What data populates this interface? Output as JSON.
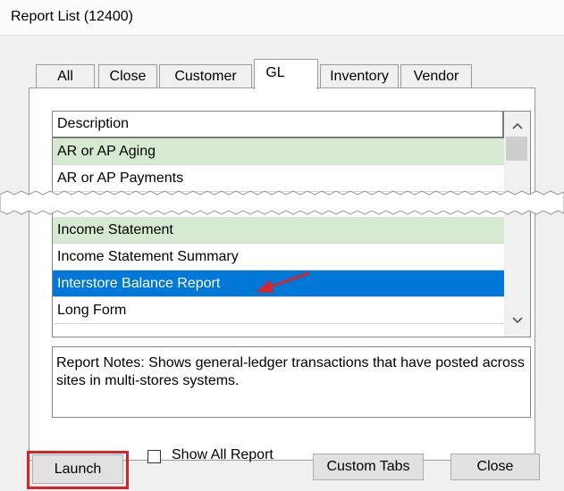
{
  "window": {
    "title": "Report List (12400)"
  },
  "tabs": [
    {
      "label": "All",
      "active": false
    },
    {
      "label": "Close",
      "active": false
    },
    {
      "label": "Customer",
      "active": false
    },
    {
      "label": "GL",
      "active": true
    },
    {
      "label": "Inventory",
      "active": false
    },
    {
      "label": "Vendor",
      "active": false
    }
  ],
  "list": {
    "header": "Description",
    "rows_top": [
      {
        "text": "AR or AP Aging",
        "style": "green"
      },
      {
        "text": "AR or AP Payments",
        "style": "normal"
      }
    ],
    "rows_bottom": [
      {
        "text": "Income Statement",
        "style": "green"
      },
      {
        "text": "Income Statement Summary",
        "style": "normal"
      },
      {
        "text": "Interstore Balance Report",
        "style": "selected"
      },
      {
        "text": "Long Form",
        "style": "normal"
      }
    ]
  },
  "scrollbar": {
    "up_icon": "chevron-up-icon",
    "down_icon": "chevron-down-icon"
  },
  "notes": {
    "text": "Report Notes:  Shows general-ledger transactions that have posted across sites in multi-stores systems."
  },
  "footer": {
    "launch": "Launch",
    "show_all": "Show All Report",
    "custom_tabs": "Custom Tabs",
    "close": "Close"
  },
  "colors": {
    "selection": "#0078d7",
    "green_row": "#d6ead2",
    "highlight": "#d8232a"
  }
}
